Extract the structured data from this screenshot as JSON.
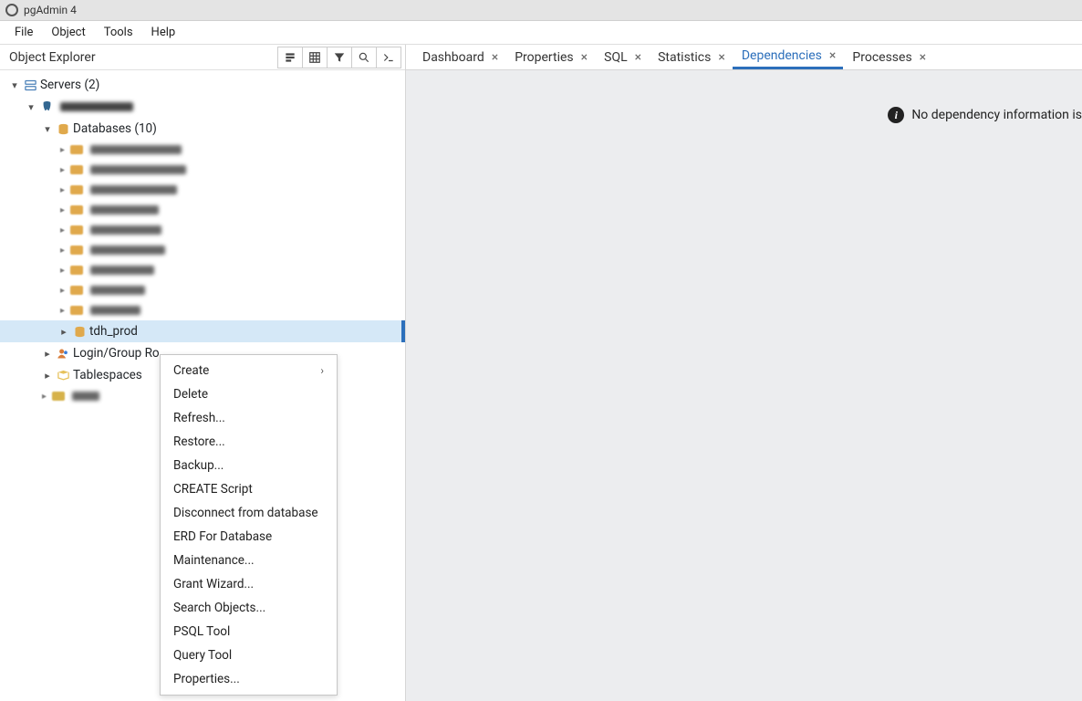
{
  "title": "pgAdmin 4",
  "menubar": [
    "File",
    "Object",
    "Tools",
    "Help"
  ],
  "sidebar": {
    "title": "Object Explorer",
    "tree": {
      "servers_label": "Servers (2)",
      "databases_label": "Databases (10)",
      "selected_db": "tdh_prod",
      "login_roles_label": "Login/Group Ro",
      "tablespaces_label": "Tablespaces"
    }
  },
  "tabs": [
    {
      "label": "Dashboard",
      "active": false
    },
    {
      "label": "Properties",
      "active": false
    },
    {
      "label": "SQL",
      "active": false
    },
    {
      "label": "Statistics",
      "active": false
    },
    {
      "label": "Dependencies",
      "active": true
    },
    {
      "label": "Processes",
      "active": false
    }
  ],
  "main": {
    "dependency_msg": "No dependency information is"
  },
  "context_menu": [
    {
      "label": "Create",
      "submenu": true
    },
    {
      "label": "Delete"
    },
    {
      "label": "Refresh..."
    },
    {
      "label": "Restore..."
    },
    {
      "label": "Backup..."
    },
    {
      "label": "CREATE Script"
    },
    {
      "label": "Disconnect from database"
    },
    {
      "label": "ERD For Database"
    },
    {
      "label": "Maintenance..."
    },
    {
      "label": "Grant Wizard..."
    },
    {
      "label": "Search Objects..."
    },
    {
      "label": "PSQL Tool"
    },
    {
      "label": "Query Tool"
    },
    {
      "label": "Properties..."
    }
  ]
}
